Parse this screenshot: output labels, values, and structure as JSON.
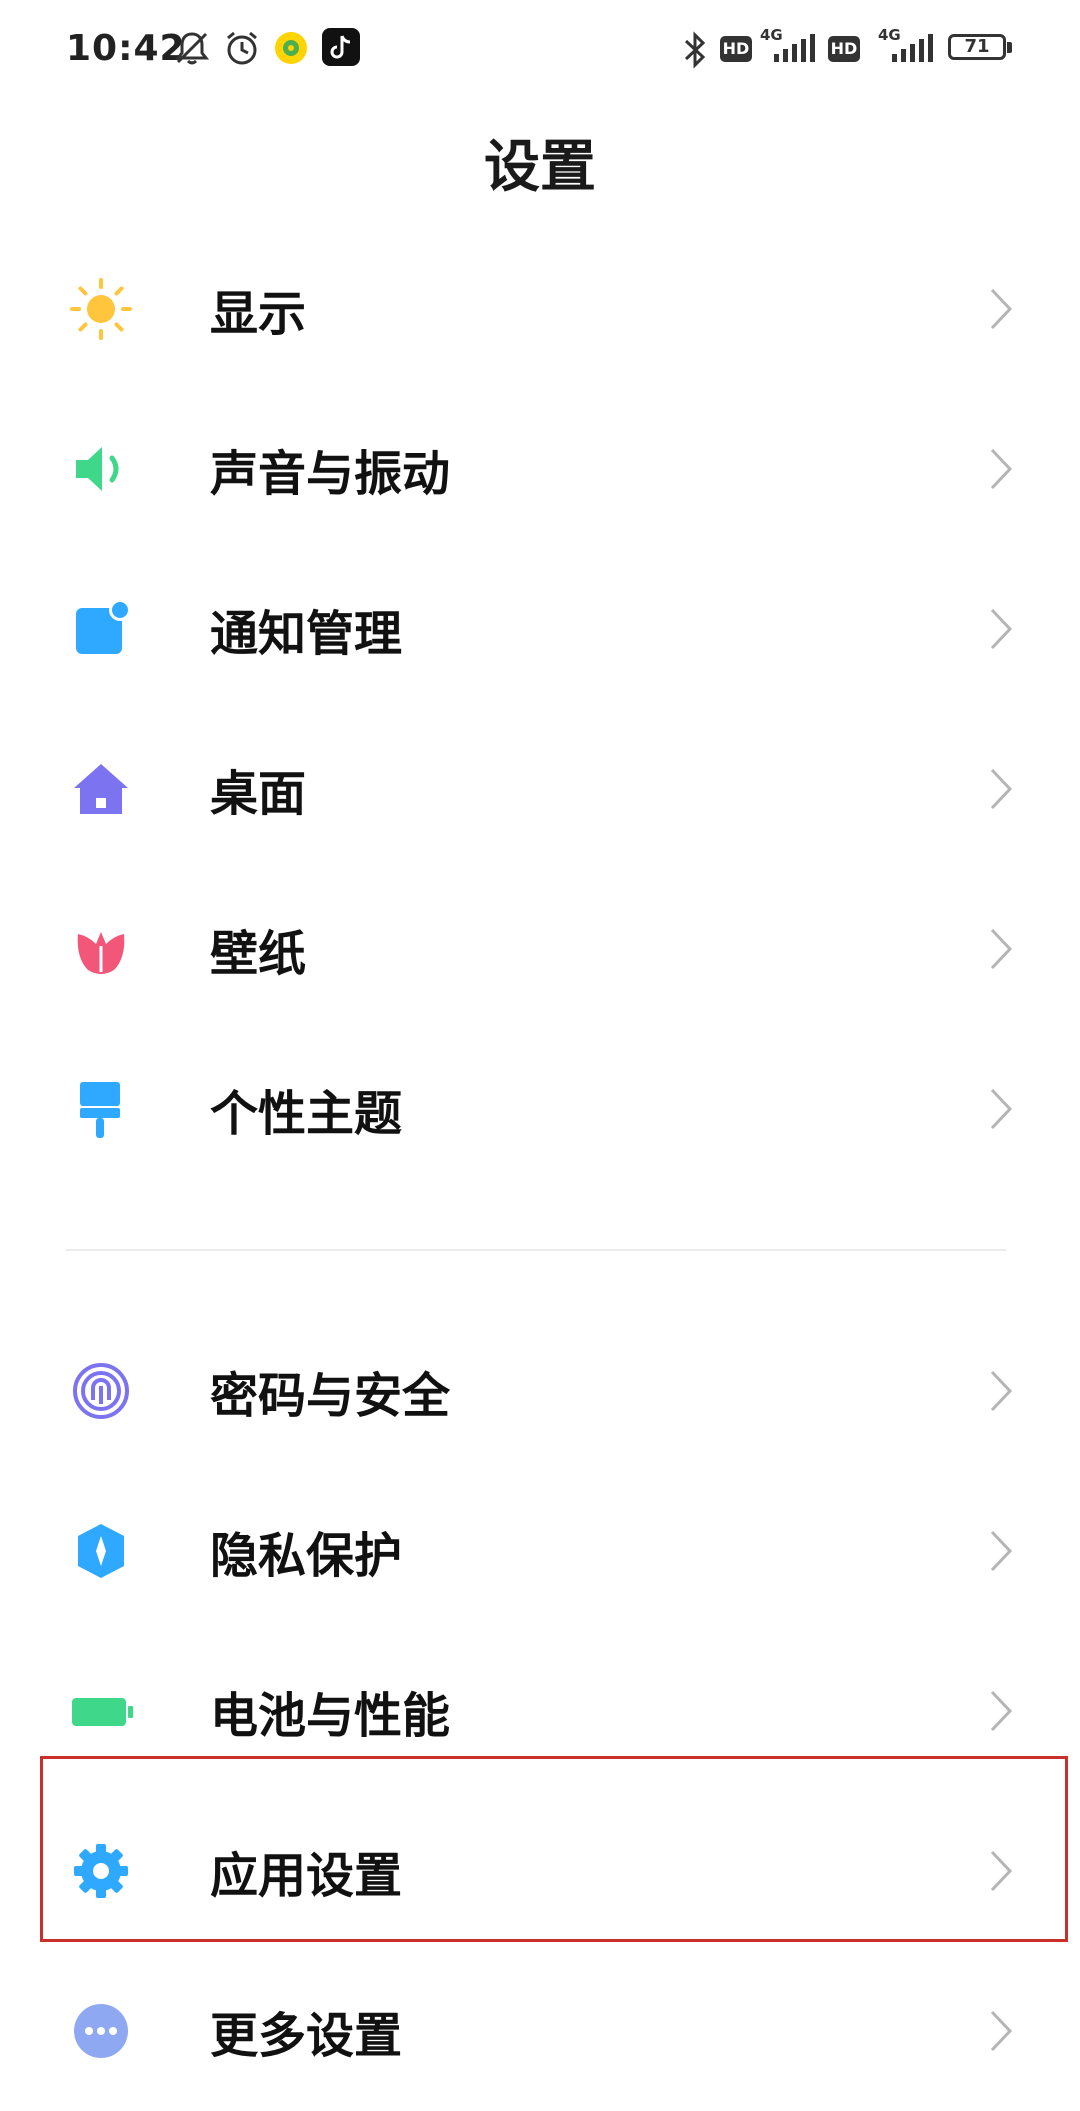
{
  "status_bar": {
    "time": "10:42",
    "battery_level": "71",
    "network_1": "4G",
    "network_2": "4G",
    "hd_badge_1": "HD",
    "hd_badge_2": "HD",
    "icons": [
      "mute-icon",
      "alarm-icon",
      "app-notification-icon",
      "tiktok-icon",
      "bluetooth-icon",
      "signal-icon",
      "battery-icon"
    ]
  },
  "header": {
    "title": "设置"
  },
  "colors": {
    "display": "#FFC53D",
    "sound": "#3FD88A",
    "notification": "#2FA9FF",
    "desktop": "#7C73F0",
    "wallpaper": "#F2577A",
    "theme": "#2FA9FF",
    "password": "#7C73F0",
    "privacy": "#2FA9FF",
    "battery": "#3FD88A",
    "apps": "#2FA9FF",
    "more": "#8FA8F2",
    "highlight": "#c9302c"
  },
  "settings": {
    "group1": [
      {
        "label": "显示",
        "icon": "sun-icon"
      },
      {
        "label": "声音与振动",
        "icon": "speaker-icon"
      },
      {
        "label": "通知管理",
        "icon": "notification-icon"
      },
      {
        "label": "桌面",
        "icon": "home-icon"
      },
      {
        "label": "壁纸",
        "icon": "tulip-icon"
      },
      {
        "label": "个性主题",
        "icon": "paintbrush-icon"
      }
    ],
    "group2": [
      {
        "label": "密码与安全",
        "icon": "fingerprint-icon"
      },
      {
        "label": "隐私保护",
        "icon": "privacy-shield-icon"
      },
      {
        "label": "电池与性能",
        "icon": "battery-icon"
      },
      {
        "label": "应用设置",
        "icon": "gear-icon",
        "highlighted": true
      },
      {
        "label": "更多设置",
        "icon": "more-dots-icon"
      }
    ]
  }
}
